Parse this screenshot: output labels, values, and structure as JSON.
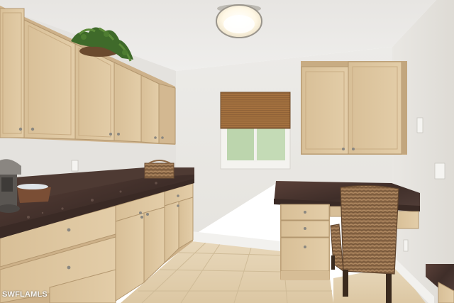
{
  "watermark": "SWFLAMLS",
  "colors": {
    "wall": "#eceae6",
    "ceiling": "#ebe9e6",
    "cabinet": "#dcc39c",
    "cabinet_shadow": "#c8ac83",
    "countertop": "#4a3630",
    "floor_tile": "#e2cfae",
    "wicker": "#9a7552"
  },
  "objects": [
    "ceiling-light",
    "upper-cabinets-left",
    "potted-plant",
    "upper-cabinets-right",
    "window-with-bamboo-shade",
    "base-cabinets-left",
    "granite-countertop-left",
    "coffee-maker",
    "wicker-basket",
    "desk-with-drawers",
    "wicker-chair",
    "tile-floor"
  ]
}
